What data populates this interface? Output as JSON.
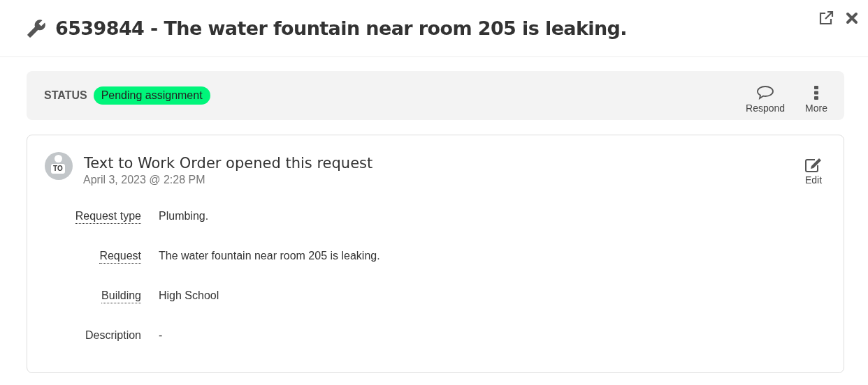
{
  "header": {
    "title": "6539844 - The water fountain near room 205 is leaking."
  },
  "status": {
    "label": "STATUS",
    "value": "Pending assignment",
    "color": "#00f57a"
  },
  "actions": [
    {
      "kind": "respond",
      "label": "Respond"
    },
    {
      "kind": "more",
      "label": "More"
    }
  ],
  "activity": {
    "avatar": "TO",
    "author_line": "Text to Work Order opened this request",
    "timestamp": "April 3, 2023 @ 2:28 PM",
    "edit_label": "Edit",
    "fields": [
      {
        "label": "Request type",
        "value": "Plumbing.",
        "underlined": true
      },
      {
        "label": "Request",
        "value": "The water fountain near room 205 is leaking.",
        "underlined": true
      },
      {
        "label": "Building",
        "value": "High School",
        "underlined": true
      },
      {
        "label": "Description",
        "value": "-",
        "underlined": false
      }
    ]
  }
}
